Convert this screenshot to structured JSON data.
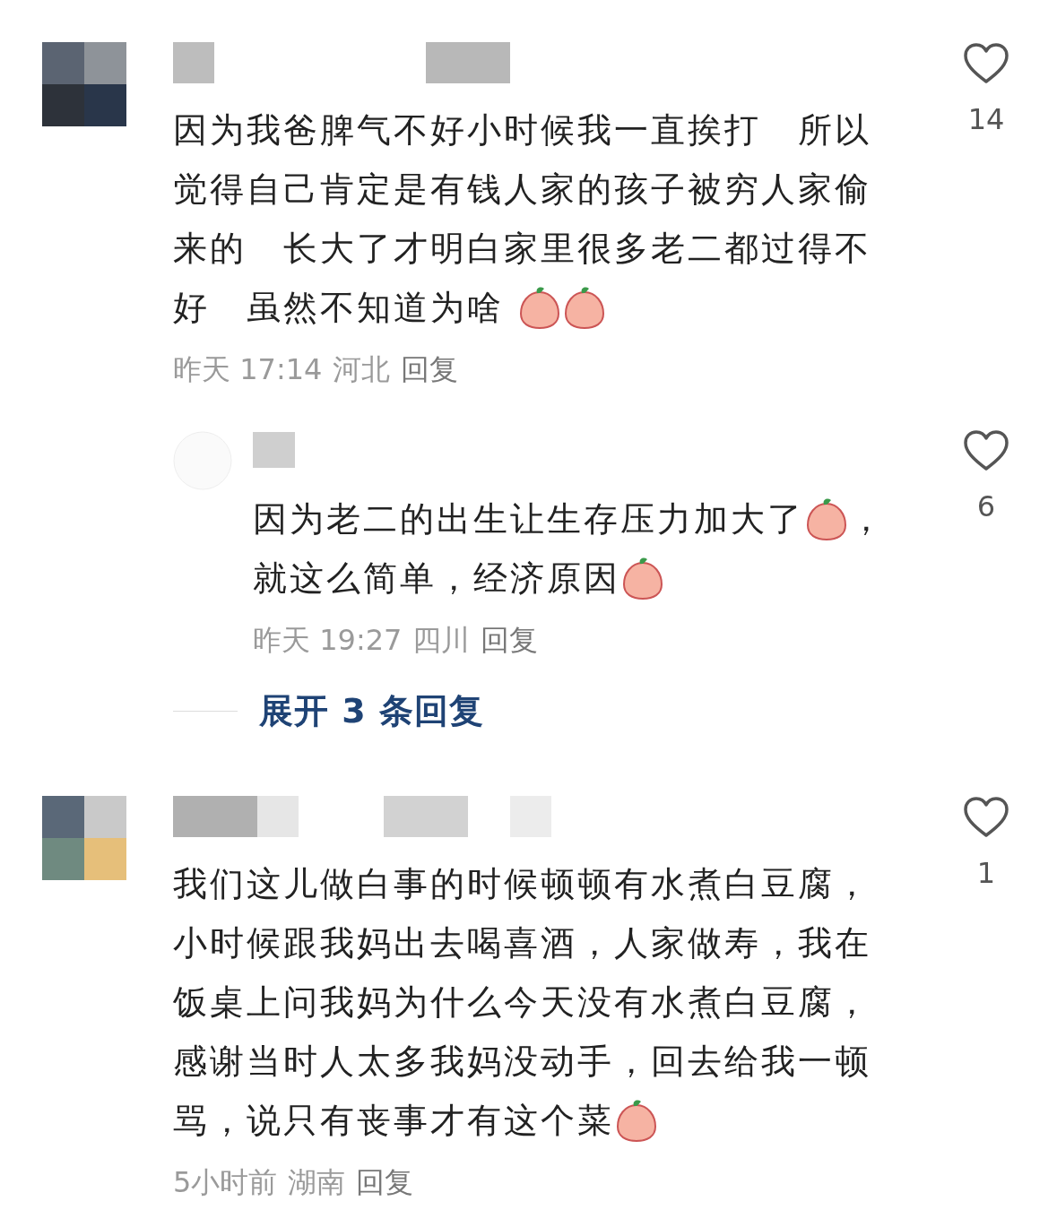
{
  "comments": [
    {
      "lines": [
        [
          {
            "kind": "text",
            "text": "因为我爸脾气不好小时候我一直挨打　所以"
          }
        ],
        [
          {
            "kind": "text",
            "text": "觉得自己肯定是有钱人家的孩子被穷人家偷"
          }
        ],
        [
          {
            "kind": "text",
            "text": "来的　长大了才明白家里很多老二都过得不"
          }
        ],
        [
          {
            "kind": "text",
            "text": "好　虽然不知道为啥 "
          },
          {
            "kind": "emoji"
          },
          {
            "kind": "emoji"
          }
        ]
      ],
      "time": "昨天 17:14",
      "location": "河北",
      "reply": "回复",
      "likes": "14",
      "liked": false,
      "replies": [
        {
          "lines": [
            [
              {
                "kind": "text",
                "text": "因为老二的出生让生存压力加大了"
              },
              {
                "kind": "emoji"
              },
              {
                "kind": "text",
                "text": "，"
              }
            ],
            [
              {
                "kind": "text",
                "text": "就这么简单，经济原因"
              },
              {
                "kind": "emoji"
              }
            ]
          ],
          "time": "昨天 19:27",
          "location": "四川",
          "reply": "回复",
          "likes": "6",
          "liked": false
        }
      ],
      "expand": "展开 3 条回复"
    },
    {
      "lines": [
        [
          {
            "kind": "text",
            "text": "我们这儿做白事的时候顿顿有水煮白豆腐，"
          }
        ],
        [
          {
            "kind": "text",
            "text": "小时候跟我妈出去喝喜酒，人家做寿，我在"
          }
        ],
        [
          {
            "kind": "text",
            "text": "饭桌上问我妈为什么今天没有水煮白豆腐，"
          }
        ],
        [
          {
            "kind": "text",
            "text": "感谢当时人太多我妈没动手，回去给我一顿"
          }
        ],
        [
          {
            "kind": "text",
            "text": "骂，说只有丧事才有这个菜"
          },
          {
            "kind": "emoji"
          }
        ]
      ],
      "time": "5小时前",
      "location": "湖南",
      "reply": "回复",
      "likes": "1",
      "liked": false
    }
  ]
}
